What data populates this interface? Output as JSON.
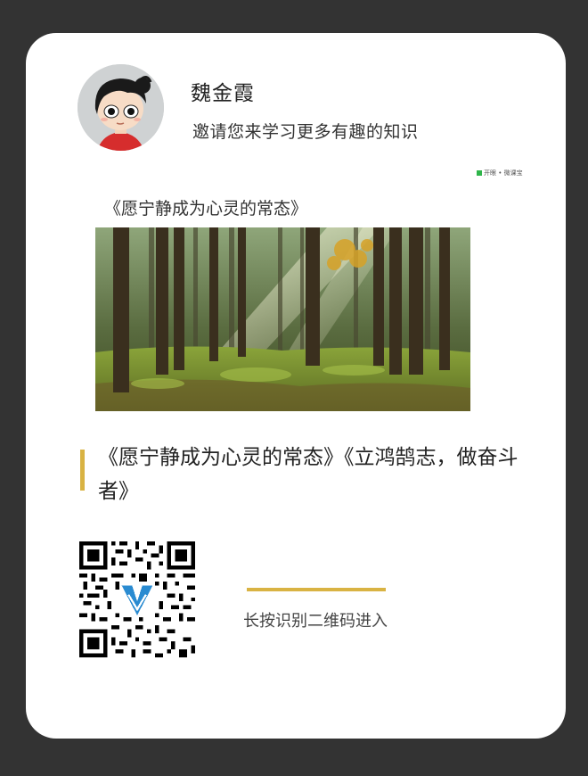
{
  "profile": {
    "name": "魏金霞",
    "invite": "邀请您来学习更多有趣的知识"
  },
  "brand": {
    "logo_text": "开眼 • 微课宝",
    "color": "#2fb54a"
  },
  "cover": {
    "caption": "《愿宁静成为心灵的常态》",
    "image": "forest-sunlight"
  },
  "course": {
    "title": "《愿宁静成为心灵的常态》《立鸿鹄志，做奋斗者》",
    "accent_color": "#d9b343"
  },
  "qr": {
    "hint": "长按识别二维码进入",
    "logo": "v-logo"
  }
}
